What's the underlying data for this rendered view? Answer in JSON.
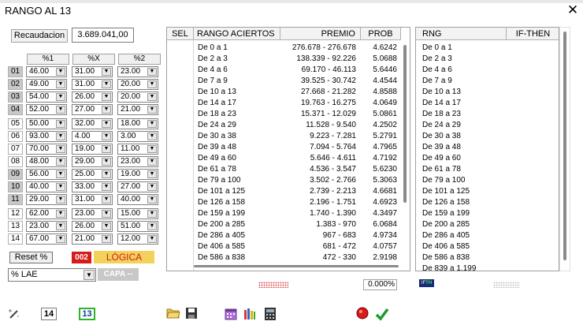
{
  "window": {
    "title": "RANGO AL 13",
    "close_glyph": "✕"
  },
  "recaudacion": {
    "label": "Recaudacion",
    "value": "3.689.041,00"
  },
  "grid": {
    "headers": [
      "%1",
      "%X",
      "%2"
    ],
    "rows": [
      {
        "num": "01",
        "c": [
          "46.00",
          "31.00",
          "23.00"
        ],
        "highlight": true
      },
      {
        "num": "02",
        "c": [
          "49.00",
          "31.00",
          "20.00"
        ],
        "highlight": true
      },
      {
        "num": "03",
        "c": [
          "54.00",
          "26.00",
          "20.00"
        ],
        "highlight": true
      },
      {
        "num": "04",
        "c": [
          "52.00",
          "27.00",
          "21.00"
        ],
        "highlight": true
      },
      {
        "num": "05",
        "c": [
          "50.00",
          "32.00",
          "18.00"
        ],
        "highlight": false
      },
      {
        "num": "06",
        "c": [
          "93.00",
          "4.00",
          "3.00"
        ],
        "highlight": false
      },
      {
        "num": "07",
        "c": [
          "70.00",
          "19.00",
          "11.00"
        ],
        "highlight": false
      },
      {
        "num": "08",
        "c": [
          "48.00",
          "29.00",
          "23.00"
        ],
        "highlight": false
      },
      {
        "num": "09",
        "c": [
          "56.00",
          "25.00",
          "19.00"
        ],
        "highlight": true
      },
      {
        "num": "10",
        "c": [
          "40.00",
          "33.00",
          "27.00"
        ],
        "highlight": true
      },
      {
        "num": "11",
        "c": [
          "29.00",
          "31.00",
          "40.00"
        ],
        "highlight": true
      },
      {
        "num": "12",
        "c": [
          "62.00",
          "23.00",
          "15.00"
        ],
        "highlight": false
      },
      {
        "num": "13",
        "c": [
          "23.00",
          "26.00",
          "51.00"
        ],
        "highlight": false
      },
      {
        "num": "14",
        "c": [
          "67.00",
          "21.00",
          "12.00"
        ],
        "highlight": false
      }
    ]
  },
  "reset_label": "Reset %",
  "badge_label": "002",
  "logica_label": "LÓGICA",
  "lae_select": "% LAE",
  "capa_label": "CAPA --",
  "main_table": {
    "headers": {
      "sel": "SEL",
      "rango": "RANGO ACIERTOS",
      "premio": "PREMIO",
      "prob": "PROB"
    },
    "rows": [
      {
        "r": "De 0 a 1",
        "p": "276.678 - 276.678",
        "b": "4.6242"
      },
      {
        "r": "De 2 a 3",
        "p": "138.339 - 92.226",
        "b": "5.0688"
      },
      {
        "r": "De 4 a 6",
        "p": "69.170 - 46.113",
        "b": "5.6446"
      },
      {
        "r": "De 7 a 9",
        "p": "39.525 - 30.742",
        "b": "4.4544"
      },
      {
        "r": "De 10 a 13",
        "p": "27.668 - 21.282",
        "b": "4.8588"
      },
      {
        "r": "De 14 a 17",
        "p": "19.763 - 16.275",
        "b": "4.0649"
      },
      {
        "r": "De 18 a 23",
        "p": "15.371 - 12.029",
        "b": "5.0861"
      },
      {
        "r": "De 24 a 29",
        "p": "11.528 - 9.540",
        "b": "4.2502"
      },
      {
        "r": "De 30 a 38",
        "p": "9.223 - 7.281",
        "b": "5.2791"
      },
      {
        "r": "De 39 a 48",
        "p": "7.094 - 5.764",
        "b": "4.7965"
      },
      {
        "r": "De 49 a 60",
        "p": "5.646 - 4.611",
        "b": "4.7192"
      },
      {
        "r": "De 61 a 78",
        "p": "4.536 - 3.547",
        "b": "5.6230"
      },
      {
        "r": "De 79 a 100",
        "p": "3.502 - 2.766",
        "b": "5.3063"
      },
      {
        "r": "De 101 a 125",
        "p": "2.739 - 2.213",
        "b": "4.6681"
      },
      {
        "r": "De 126 a 158",
        "p": "2.196 - 1.751",
        "b": "4.6923"
      },
      {
        "r": "De 159 a 199",
        "p": "1.740 - 1.390",
        "b": "4.3497"
      },
      {
        "r": "De 200 a 285",
        "p": "1.383 - 970",
        "b": "6.0684"
      },
      {
        "r": "De 286 a 405",
        "p": "967 - 683",
        "b": "4.9734"
      },
      {
        "r": "De 406 a 585",
        "p": "681 - 472",
        "b": "4.0757"
      },
      {
        "r": "De 586 a 838",
        "p": "472 - 330",
        "b": "2.9198"
      }
    ]
  },
  "rng_list": {
    "headers": {
      "rng": "RNG",
      "ifthen": "IF-THEN"
    },
    "items": [
      "De 0 a 1",
      "De 2 a 3",
      "De 4 a 6",
      "De 7 a 9",
      "De 10 a 13",
      "De 14 a 17",
      "De 18 a 23",
      "De 24 a 29",
      "De 30 a 38",
      "De 39 a 48",
      "De 49 a 60",
      "De 61 a 78",
      "De 79 a 100",
      "De 101 a 125",
      "De 126 a 158",
      "De 159 a 199",
      "De 200 a 285",
      "De 286 a 405",
      "De 406 a 585",
      "De 586 a 838",
      "De 839 a 1.199"
    ]
  },
  "percent_value": "0.000%",
  "ifth": {
    "a": "IF",
    "b": "TH"
  },
  "bottom": {
    "box14": "14",
    "box13": "13"
  },
  "icons": {
    "wand": "magic-wand-icon",
    "folder": "folder-open-icon",
    "save": "save-icon",
    "calendar": "calendar-icon",
    "books": "books-icon",
    "calc": "calculator-icon",
    "record": "record-icon",
    "check": "checkmark-icon"
  },
  "colors": {
    "badge": "#d51b1b",
    "logica_bg": "#f3d25b",
    "logica_text": "#d51b1b",
    "box13_border": "#2bb52b"
  }
}
